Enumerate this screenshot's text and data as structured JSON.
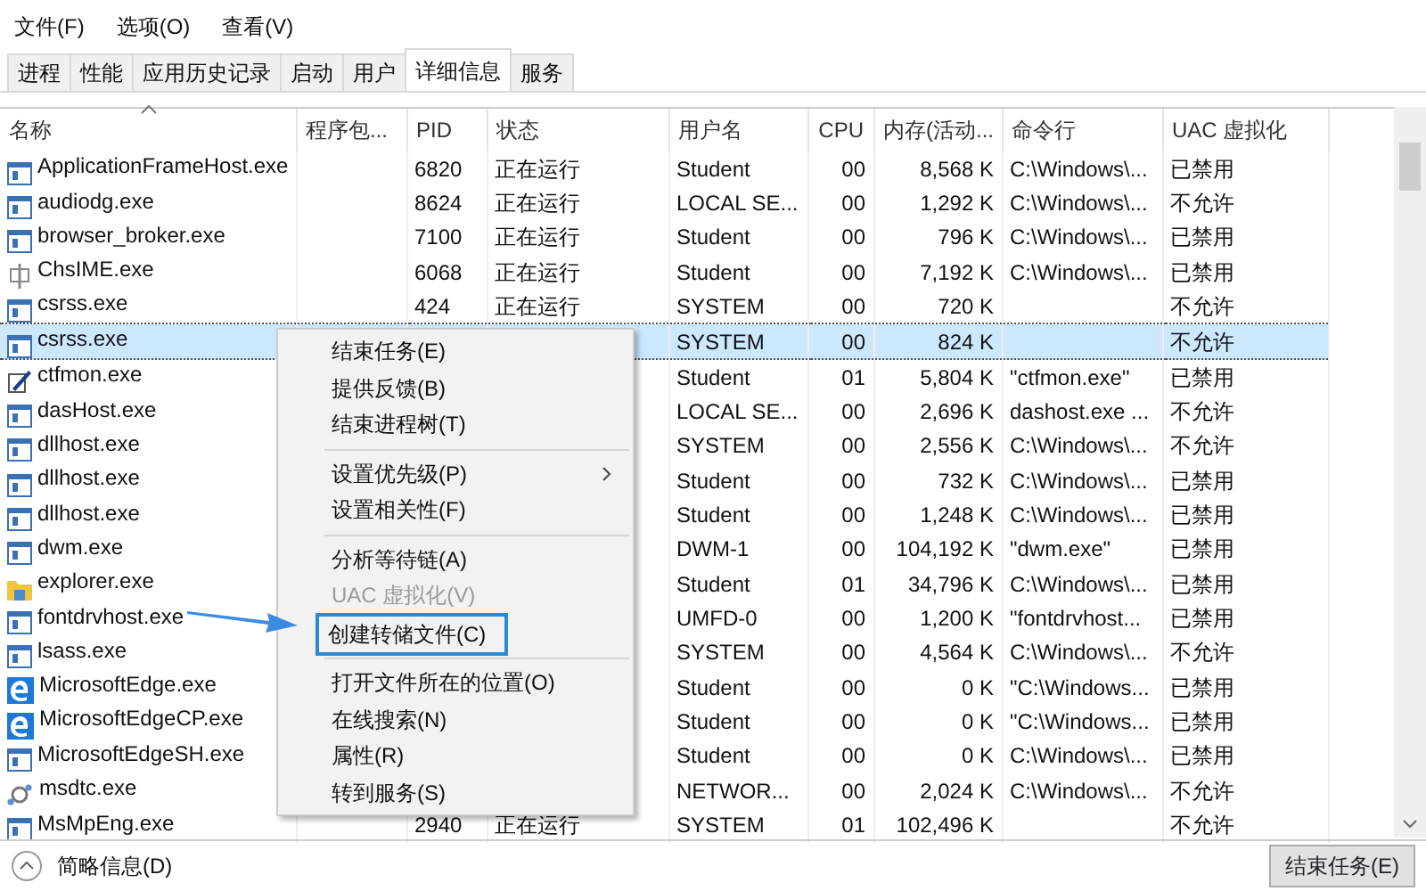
{
  "menu_bar": [
    "文件(F)",
    "选项(O)",
    "查看(V)"
  ],
  "tabs": [
    {
      "label": "进程",
      "selected": false
    },
    {
      "label": "性能",
      "selected": false
    },
    {
      "label": "应用历史记录",
      "selected": false
    },
    {
      "label": "启动",
      "selected": false
    },
    {
      "label": "用户",
      "selected": false
    },
    {
      "label": "详细信息",
      "selected": true
    },
    {
      "label": "服务",
      "selected": false
    }
  ],
  "table": {
    "columns": [
      "名称",
      "程序包...",
      "PID",
      "状态",
      "用户名",
      "CPU",
      "内存(活动...",
      "命令行",
      "UAC 虚拟化"
    ],
    "rows": [
      {
        "kind": "app",
        "name": "ApplicationFrameHost.exe",
        "pid": "6820",
        "status": "正在运行",
        "user": "Student",
        "cpu": "00",
        "memory": "8,568 K",
        "command": "C:\\Windows\\...",
        "uac": "已禁用",
        "selected": false
      },
      {
        "kind": "app",
        "name": "audiodg.exe",
        "pid": "8624",
        "status": "正在运行",
        "user": "LOCAL SE...",
        "cpu": "00",
        "memory": "1,292 K",
        "command": "C:\\Windows\\...",
        "uac": "不允许",
        "selected": false
      },
      {
        "kind": "app",
        "name": "browser_broker.exe",
        "pid": "7100",
        "status": "正在运行",
        "user": "Student",
        "cpu": "00",
        "memory": "796 K",
        "command": "C:\\Windows\\...",
        "uac": "已禁用",
        "selected": false
      },
      {
        "kind": "ime",
        "name": "ChsIME.exe",
        "pid": "6068",
        "status": "正在运行",
        "user": "Student",
        "cpu": "00",
        "memory": "7,192 K",
        "command": "C:\\Windows\\...",
        "uac": "已禁用",
        "selected": false
      },
      {
        "kind": "app",
        "name": "csrss.exe",
        "pid": "424",
        "status": "正在运行",
        "user": "SYSTEM",
        "cpu": "00",
        "memory": "720 K",
        "uac": "不允许",
        "selected": false
      },
      {
        "kind": "app",
        "name": "csrss.exe",
        "user": "SYSTEM",
        "cpu": "00",
        "memory": "824 K",
        "uac": "不允许",
        "selected": true
      },
      {
        "kind": "pen",
        "name": "ctfmon.exe",
        "user": "Student",
        "cpu": "01",
        "memory": "5,804 K",
        "command": "\"ctfmon.exe\"",
        "uac": "已禁用",
        "selected": false
      },
      {
        "kind": "app",
        "name": "dasHost.exe",
        "user": "LOCAL SE...",
        "cpu": "00",
        "memory": "2,696 K",
        "command": "dashost.exe ...",
        "uac": "不允许",
        "selected": false
      },
      {
        "kind": "app",
        "name": "dllhost.exe",
        "user": "SYSTEM",
        "cpu": "00",
        "memory": "2,556 K",
        "command": "C:\\Windows\\...",
        "uac": "不允许",
        "selected": false
      },
      {
        "kind": "app",
        "name": "dllhost.exe",
        "user": "Student",
        "cpu": "00",
        "memory": "732 K",
        "command": "C:\\Windows\\...",
        "uac": "已禁用",
        "selected": false
      },
      {
        "kind": "app",
        "name": "dllhost.exe",
        "user": "Student",
        "cpu": "00",
        "memory": "1,248 K",
        "command": "C:\\Windows\\...",
        "uac": "已禁用",
        "selected": false
      },
      {
        "kind": "app",
        "name": "dwm.exe",
        "user": "DWM-1",
        "cpu": "00",
        "memory": "104,192 K",
        "command": "\"dwm.exe\"",
        "uac": "已禁用",
        "selected": false
      },
      {
        "kind": "folder",
        "name": "explorer.exe",
        "user": "Student",
        "cpu": "01",
        "memory": "34,796 K",
        "command": "C:\\Windows\\...",
        "uac": "已禁用",
        "selected": false
      },
      {
        "kind": "app",
        "name": "fontdrvhost.exe",
        "user": "UMFD-0",
        "cpu": "00",
        "memory": "1,200 K",
        "command": "\"fontdrvhost...",
        "uac": "已禁用",
        "selected": false
      },
      {
        "kind": "app",
        "name": "lsass.exe",
        "user": "SYSTEM",
        "cpu": "00",
        "memory": "4,564 K",
        "command": "C:\\Windows\\...",
        "uac": "不允许",
        "selected": false
      },
      {
        "kind": "edge",
        "name": "MicrosoftEdge.exe",
        "user": "Student",
        "cpu": "00",
        "memory": "0 K",
        "command": "\"C:\\Windows...",
        "uac": "已禁用",
        "selected": false
      },
      {
        "kind": "edge",
        "name": "MicrosoftEdgeCP.exe",
        "user": "Student",
        "cpu": "00",
        "memory": "0 K",
        "command": "\"C:\\Windows...",
        "uac": "已禁用",
        "selected": false
      },
      {
        "kind": "app",
        "name": "MicrosoftEdgeSH.exe",
        "user": "Student",
        "cpu": "00",
        "memory": "0 K",
        "command": "C:\\Windows\\...",
        "uac": "已禁用",
        "selected": false
      },
      {
        "kind": "service",
        "name": "msdtc.exe",
        "user": "NETWOR...",
        "cpu": "00",
        "memory": "2,024 K",
        "command": "C:\\Windows\\...",
        "uac": "不允许",
        "selected": false
      },
      {
        "kind": "app",
        "name": "MsMpEng.exe",
        "pid": "2940",
        "status": "正在运行",
        "user": "SYSTEM",
        "cpu": "01",
        "memory": "102,496 K",
        "uac": "不允许",
        "selected": false
      }
    ]
  },
  "context_menu": [
    {
      "items": [
        {
          "label": "结束任务(E)",
          "disabled": false,
          "highlighted": false,
          "submenu": false
        },
        {
          "label": "提供反馈(B)",
          "disabled": false,
          "highlighted": false,
          "submenu": false
        },
        {
          "label": "结束进程树(T)",
          "disabled": false,
          "highlighted": false,
          "submenu": false
        }
      ]
    },
    {
      "items": [
        {
          "label": "设置优先级(P)",
          "disabled": false,
          "highlighted": false,
          "submenu": true
        },
        {
          "label": "设置相关性(F)",
          "disabled": false,
          "highlighted": false,
          "submenu": false
        }
      ]
    },
    {
      "items": [
        {
          "label": "分析等待链(A)",
          "disabled": false,
          "highlighted": false,
          "submenu": false
        },
        {
          "label": "UAC 虚拟化(V)",
          "disabled": true,
          "highlighted": false,
          "submenu": false
        },
        {
          "label": "创建转储文件(C)",
          "disabled": false,
          "highlighted": true,
          "submenu": false
        }
      ]
    },
    {
      "items": [
        {
          "label": "打开文件所在的位置(O)",
          "disabled": false,
          "highlighted": false,
          "submenu": false
        },
        {
          "label": "在线搜索(N)",
          "disabled": false,
          "highlighted": false,
          "submenu": false
        },
        {
          "label": "属性(R)",
          "disabled": false,
          "highlighted": false,
          "submenu": false
        },
        {
          "label": "转到服务(S)",
          "disabled": false,
          "highlighted": false,
          "submenu": false
        }
      ]
    }
  ],
  "footer": {
    "details_toggle": "简略信息(D)",
    "end_task_button": "结束任务(E)"
  }
}
